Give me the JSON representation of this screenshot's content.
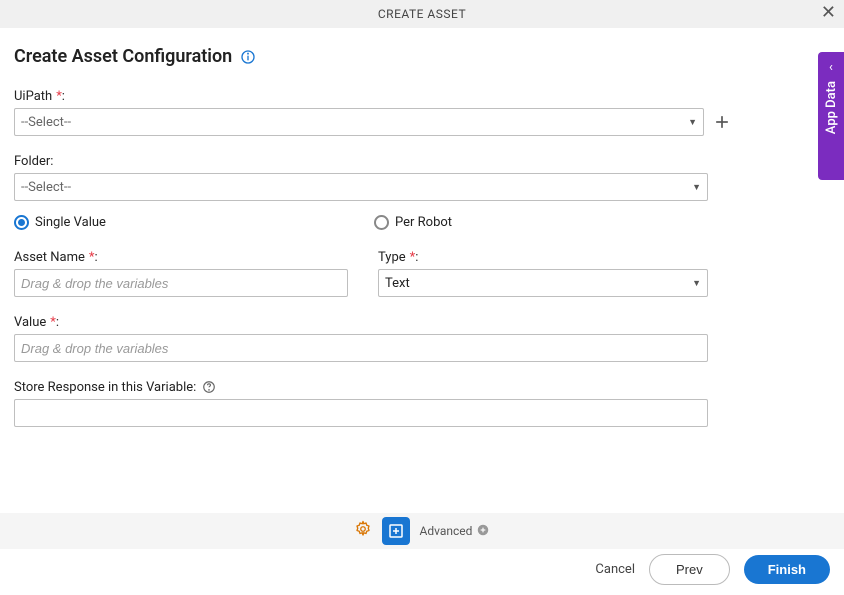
{
  "header": {
    "title": "CREATE ASSET"
  },
  "page": {
    "title": "Create Asset Configuration"
  },
  "fields": {
    "uipath": {
      "label": "UiPath",
      "required": "*",
      "colon": ":",
      "value": "--Select--"
    },
    "folder": {
      "label": "Folder:",
      "value": "--Select--"
    },
    "radio": {
      "single": "Single Value",
      "per_robot": "Per Robot"
    },
    "asset_name": {
      "label": "Asset Name",
      "required": "*",
      "colon": ":",
      "placeholder": "Drag & drop the variables"
    },
    "type": {
      "label": "Type",
      "required": "*",
      "colon": ":",
      "value": "Text"
    },
    "value": {
      "label": "Value",
      "required": "*",
      "colon": ":",
      "placeholder": "Drag & drop the variables"
    },
    "store_response": {
      "label": "Store Response in this Variable:"
    }
  },
  "sidebar": {
    "label": "App Data"
  },
  "toolbar": {
    "advanced": "Advanced"
  },
  "buttons": {
    "cancel": "Cancel",
    "prev": "Prev",
    "finish": "Finish"
  }
}
